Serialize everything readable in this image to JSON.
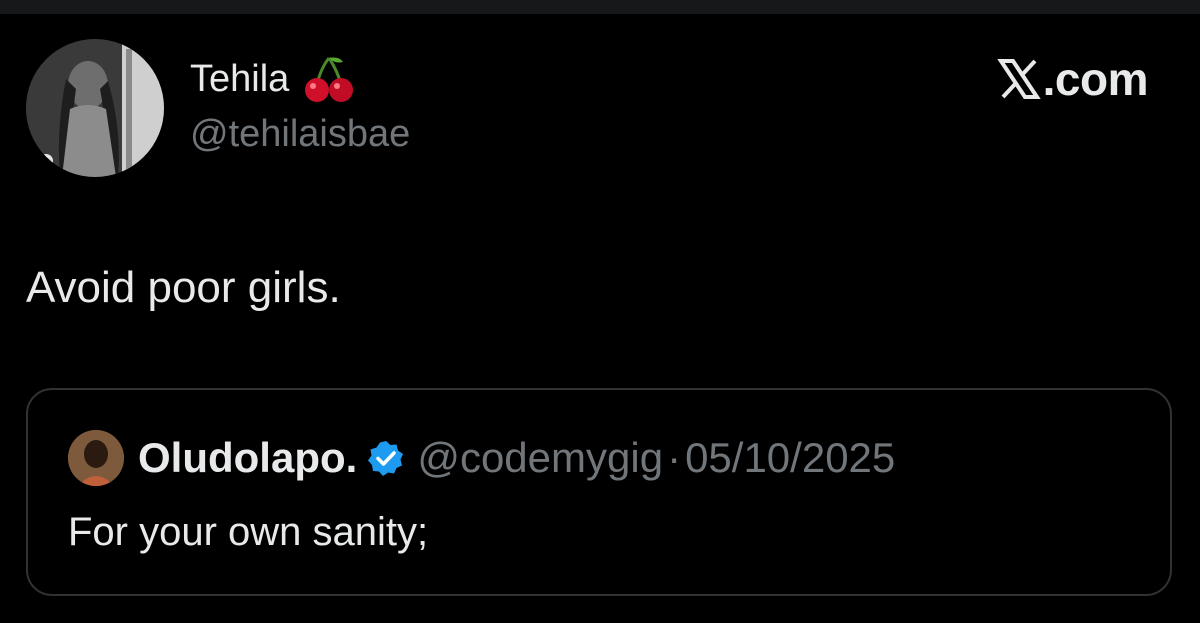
{
  "author": {
    "display_name": "Tehila",
    "name_emoji": "cherry-emoji",
    "handle": "@tehilaisbae",
    "avatar": "profile-photo"
  },
  "brand": {
    "logo": "x-logo-icon",
    "label": ".com"
  },
  "tweet": {
    "text": "Avoid poor girls."
  },
  "quoted_tweet": {
    "display_name": "Oludolapo.",
    "verified": true,
    "handle": "@codemygig",
    "separator": "·",
    "date": "05/10/2025",
    "text": "For your own sanity;"
  },
  "colors": {
    "background": "#000000",
    "primary_text": "#e7e9ea",
    "secondary_text": "#71767b",
    "border": "#2f3336",
    "verified_blue": "#1d9bf0"
  }
}
